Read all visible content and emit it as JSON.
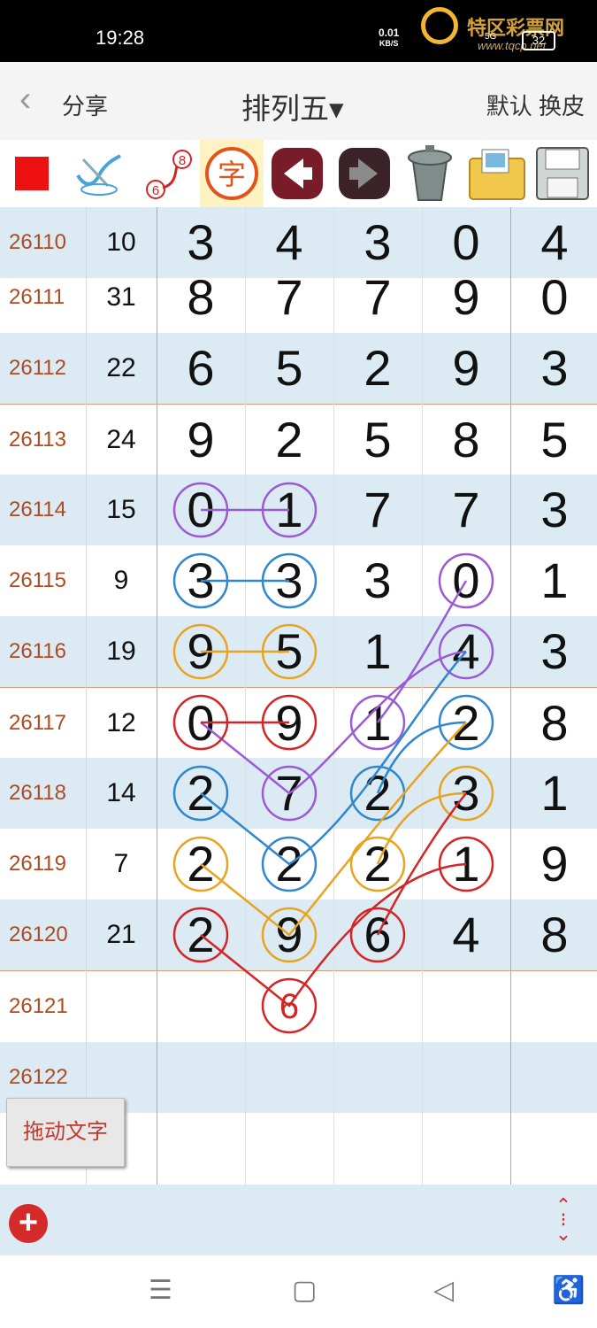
{
  "status_bar": {
    "time": "19:28",
    "speed_value": "0.01",
    "speed_unit": "KB/S",
    "signal": "5G",
    "battery": "32",
    "watermark_cn": "特区彩票网",
    "watermark_url": "www.tqcp.net"
  },
  "header": {
    "back_icon": "chevron-left-icon",
    "share_label": "分享",
    "title": "排列五▾",
    "default_label": "默认",
    "skin_label": "换皮"
  },
  "toolbar": {
    "items": [
      "red-square-icon",
      "pen-check-icon",
      "connect-6-8-icon",
      "char-zi-icon",
      "left-arrow-icon",
      "right-arrow-icon",
      "trash-icon",
      "photo-folder-icon",
      "save-disk-icon"
    ],
    "badge_6": "6",
    "badge_8": "8",
    "zi_label": "字"
  },
  "colors": {
    "purple": "#9a5ad8",
    "blue": "#2f87d0",
    "orange": "#e8a320",
    "red": "#d42424",
    "issue_text": "#b04a20"
  },
  "rows": [
    {
      "issue": "26110",
      "sum": "10",
      "digits": [
        "3",
        "4",
        "3",
        "0",
        "4"
      ]
    },
    {
      "issue": "26111",
      "sum": "31",
      "digits": [
        "8",
        "7",
        "7",
        "9",
        "0"
      ]
    },
    {
      "issue": "26112",
      "sum": "22",
      "digits": [
        "6",
        "5",
        "2",
        "9",
        "3"
      ]
    },
    {
      "issue": "26113",
      "sum": "24",
      "digits": [
        "9",
        "2",
        "5",
        "8",
        "5"
      ]
    },
    {
      "issue": "26114",
      "sum": "15",
      "digits": [
        "0",
        "1",
        "7",
        "7",
        "3"
      ]
    },
    {
      "issue": "26115",
      "sum": "9",
      "digits": [
        "3",
        "3",
        "3",
        "0",
        "1"
      ]
    },
    {
      "issue": "26116",
      "sum": "19",
      "digits": [
        "9",
        "5",
        "1",
        "4",
        "3"
      ]
    },
    {
      "issue": "26117",
      "sum": "12",
      "digits": [
        "0",
        "9",
        "1",
        "2",
        "8"
      ]
    },
    {
      "issue": "26118",
      "sum": "14",
      "digits": [
        "2",
        "7",
        "2",
        "3",
        "1"
      ]
    },
    {
      "issue": "26119",
      "sum": "7",
      "digits": [
        "2",
        "2",
        "2",
        "1",
        "9"
      ]
    },
    {
      "issue": "26120",
      "sum": "21",
      "digits": [
        "2",
        "9",
        "6",
        "4",
        "8"
      ]
    },
    {
      "issue": "26121",
      "sum": "",
      "digits": [
        "",
        "6",
        "",
        "",
        ""
      ]
    },
    {
      "issue": "26122",
      "sum": "",
      "digits": [
        "",
        "",
        "",
        "",
        ""
      ]
    }
  ],
  "drag_text_button": "拖动文字",
  "bottom": {
    "add_icon": "plus-circle-icon",
    "resize_icon": "expand-vertical-icon"
  },
  "navbar": {
    "menu_icon": "menu-icon",
    "home_icon": "home-square-icon",
    "back_icon": "back-triangle-icon",
    "accessibility_icon": "accessibility-icon"
  }
}
